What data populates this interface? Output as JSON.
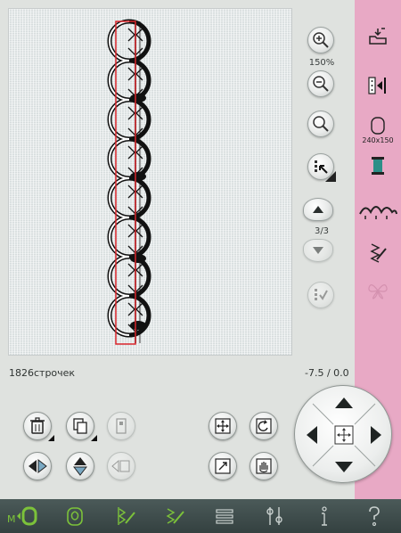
{
  "canvas": {
    "zoom_label": "150%",
    "page_label": "3/3"
  },
  "side_panel": {
    "hoop_size_label": "240x150"
  },
  "status": {
    "stitch_count": "1826строчек",
    "position": "-7.5 / 0.0"
  },
  "colors": {
    "accent_pink": "#e8a9c5",
    "taskbar": "#3b4847",
    "icon_green": "#7cc23a",
    "selection_red": "#d9252b"
  },
  "icons": {
    "zoom_in": "zoom-in-icon",
    "zoom_out": "zoom-out-icon",
    "zoom_fit": "magnifier-icon",
    "select": "select-cursor-icon",
    "page_up": "arrow-up-icon",
    "page_down": "arrow-down-icon",
    "change_color": "thread-color-icon",
    "open_folder": "open-folder-icon",
    "needle_position": "needle-position-icon",
    "hoop": "hoop-icon",
    "thread_spool": "thread-spool-icon",
    "embroidery_design": "embroidery-design-icon",
    "stitch_program": "stitch-program-icon",
    "butterfly": "butterfly-icon",
    "delete": "trash-icon",
    "copy": "copy-icon",
    "group": "group-icon",
    "mirror_h": "mirror-horizontal-icon",
    "mirror_v": "mirror-vertical-icon",
    "mirror_disabled": "mirror-disabled-icon",
    "move": "move-icon",
    "rotate": "rotate-icon",
    "scale": "scale-icon",
    "pan": "hand-icon",
    "dpad_center": "center-move-icon"
  },
  "taskbar": [
    {
      "name": "taskbar-embroidery-mode",
      "icon": "embroidery-mode-icon"
    },
    {
      "name": "taskbar-design",
      "icon": "design-icon"
    },
    {
      "name": "taskbar-stitch-edit",
      "icon": "stitch-edit-icon"
    },
    {
      "name": "taskbar-stitch-program",
      "icon": "stitch-program-icon"
    },
    {
      "name": "taskbar-list",
      "icon": "list-icon"
    },
    {
      "name": "taskbar-settings",
      "icon": "settings-icon"
    },
    {
      "name": "taskbar-info",
      "icon": "info-icon"
    },
    {
      "name": "taskbar-help",
      "icon": "help-icon"
    }
  ]
}
